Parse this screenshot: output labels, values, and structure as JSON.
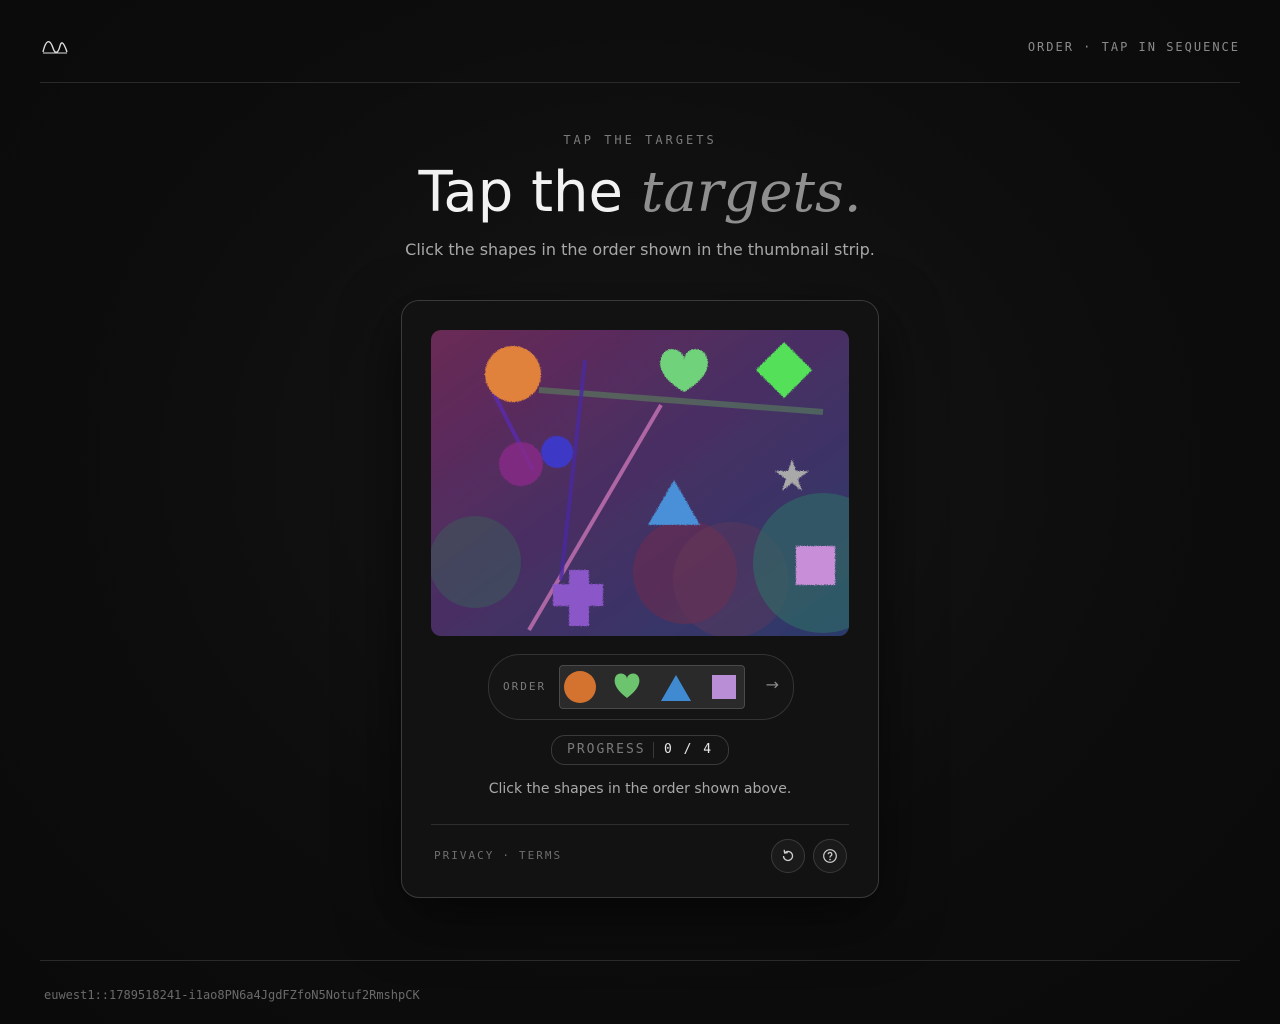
{
  "header": {
    "tag": "ORDER · TAP IN SEQUENCE"
  },
  "hero": {
    "eyebrow": "TAP THE TARGETS",
    "title_plain": "Tap the",
    "title_accent": "targets.",
    "subtitle": "Click the shapes in the order shown in the thumbnail strip."
  },
  "challenge": {
    "canvas_shapes": [
      {
        "shape": "circle",
        "color": "#e0823a"
      },
      {
        "shape": "heart",
        "color": "#6fd27a"
      },
      {
        "shape": "diamond",
        "color": "#55e05a"
      },
      {
        "shape": "star",
        "color": "#a9a9a9"
      },
      {
        "shape": "triangle",
        "color": "#4a90d9"
      },
      {
        "shape": "square",
        "color": "#c98ed8"
      },
      {
        "shape": "cross",
        "color": "#8a56c8"
      },
      {
        "shape": "circle",
        "color": "#3a3ad0"
      },
      {
        "shape": "circle",
        "color": "#8a2a8a"
      }
    ],
    "order_label": "ORDER",
    "order_sequence": [
      {
        "shape": "circle",
        "color": "#d4732f"
      },
      {
        "shape": "heart",
        "color": "#6cc46e"
      },
      {
        "shape": "triangle",
        "color": "#3f8ad1"
      },
      {
        "shape": "square",
        "color": "#b98ed6"
      }
    ],
    "order_arrow": "→",
    "progress_label": "PROGRESS",
    "progress_value": "0 / 4",
    "instruction": "Click the shapes in the order shown above."
  },
  "footer_links": {
    "privacy": "PRIVACY",
    "separator": "·",
    "terms": "TERMS"
  },
  "icons": {
    "logo": "wave-logo-icon",
    "refresh": "refresh-icon",
    "help": "help-icon"
  },
  "session_id": "euwest1::1789518241-i1ao8PN6a4JgdFZfoN5Notuf2RmshpCK"
}
